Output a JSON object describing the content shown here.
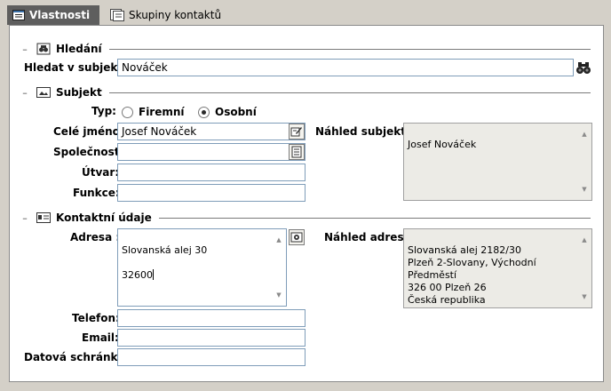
{
  "tabs": [
    {
      "label": "Vlastnosti",
      "icon": "properties-icon",
      "active": true
    },
    {
      "label": "Skupiny kontaktů",
      "icon": "contact-groups-icon",
      "active": false
    }
  ],
  "search_section": {
    "title": "Hledání",
    "collapse": "–",
    "field_label": "Hledat v subjektu:",
    "field_value": "Nováček",
    "icon": "binoculars-icon"
  },
  "subject_section": {
    "title": "Subjekt",
    "collapse": "–",
    "type_label": "Typ:",
    "radio_company": "Firemní",
    "radio_personal": "Osobní",
    "selected_type": "Osobní",
    "fullname_label": "Celé jméno:",
    "fullname_value": "Josef Nováček",
    "company_label": "Společnost:",
    "company_value": "",
    "department_label": "Útvar:",
    "department_value": "",
    "function_label": "Funkce:",
    "function_value": "",
    "preview_label": "Náhled subjektu:",
    "preview_value": "Josef Nováček"
  },
  "contact_section": {
    "title": "Kontaktní údaje",
    "collapse": "–",
    "address_label": "Adresa :",
    "address_line1": "Slovanská alej 30",
    "address_line2": "32600",
    "address_preview_label": "Náhled adresy:",
    "address_preview": "Slovanská alej 2182/30\nPlzeň 2-Slovany, Východní Předměstí\n326 00 Plzeň 26\nČeská republika",
    "phone_label": "Telefon:",
    "phone_value": "",
    "email_label": "Email:",
    "email_value": "",
    "databox_label": "Datová schránka:",
    "databox_value": ""
  },
  "colors": {
    "active_tab": "#5e5e5e",
    "window_bg": "#d4d0c8",
    "input_border": "#7f9db9",
    "readonly_bg": "#ecebe6"
  }
}
